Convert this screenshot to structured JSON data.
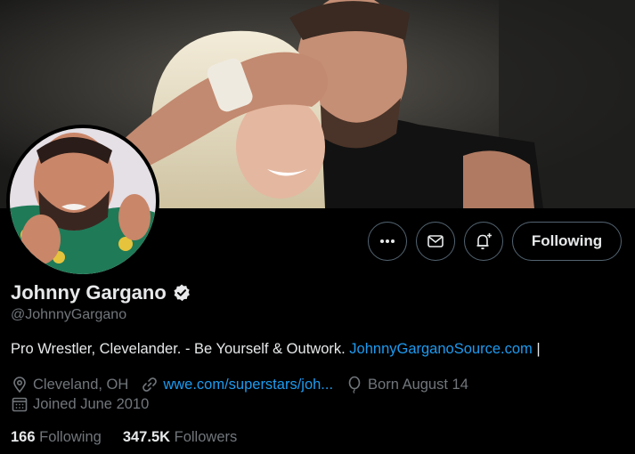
{
  "profile": {
    "name": "Johnny Gargano",
    "handle": "@JohnnyGargano",
    "bio_text": "Pro Wrestler, Clevelander. - Be Yourself & Outwork. ",
    "bio_link": "JohnnyGarganoSource.com",
    "bio_suffix": " |",
    "location": "Cleveland, OH",
    "website": "wwe.com/superstars/joh...",
    "birthday": "Born August 14",
    "joined": "Joined June 2010",
    "following_count": "166",
    "following_label": "Following",
    "followers_count": "347.5K",
    "followers_label": "Followers"
  },
  "actions": {
    "more_icon": "more-horizontal-icon",
    "message_icon": "envelope-icon",
    "notify_icon": "bell-plus-icon",
    "following_label": "Following"
  },
  "colors": {
    "background": "#000000",
    "text": "#e7e9ea",
    "muted": "#71767b",
    "link": "#1d9bf0",
    "border": "#536471"
  }
}
